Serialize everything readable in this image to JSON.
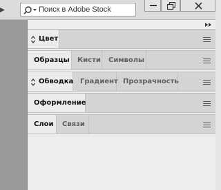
{
  "topbar": {
    "search": {
      "placeholder": "Поиск в Adobe Stock",
      "icon": "search-icon"
    },
    "window_buttons": [
      "minimize-icon",
      "restore-icon",
      "close-icon"
    ]
  },
  "panels": [
    {
      "tabs": [
        {
          "label": "Цвет",
          "active": true,
          "collapsible": true
        }
      ]
    },
    {
      "tabs": [
        {
          "label": "Образцы",
          "active": true
        },
        {
          "label": "Кисти",
          "active": false
        },
        {
          "label": "Символы",
          "active": false
        }
      ]
    },
    {
      "tabs": [
        {
          "label": "Обводка",
          "active": true,
          "collapsible": true
        },
        {
          "label": "Градиент",
          "active": false
        },
        {
          "label": "Прозрачность",
          "active": false
        }
      ]
    },
    {
      "tabs": [
        {
          "label": "Оформление",
          "active": true
        }
      ]
    },
    {
      "tabs": [
        {
          "label": "Слои",
          "active": true
        },
        {
          "label": "Связи",
          "active": false
        }
      ]
    }
  ],
  "colors": {
    "topbar": "#dcdcdc",
    "header": "#d4d4d4",
    "active_tab": "#ececec",
    "panel_body": "#ededed",
    "left_strip": "#9a9a9a"
  }
}
